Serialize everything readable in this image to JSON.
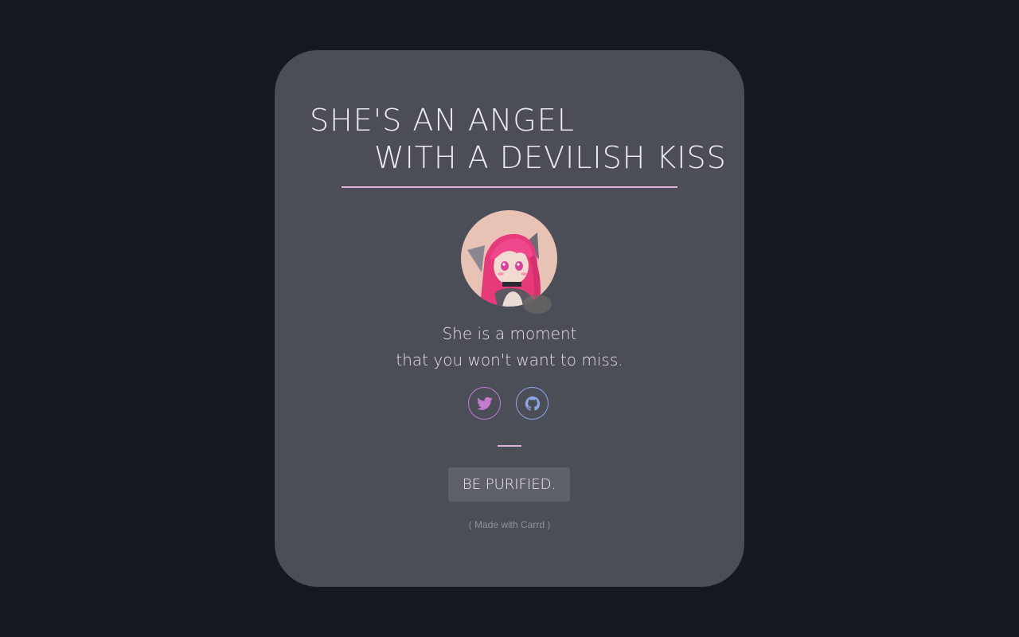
{
  "card": {
    "title_line1": "SHE'S AN ANGEL",
    "title_line2": "WITH A DEVILISH KISS",
    "tagline_line1": "She is a moment",
    "tagline_line2": "that you won't want to miss.",
    "button_label": "BE PURIFIED.",
    "credit": "( Made with Carrd )"
  },
  "social": [
    {
      "icon": "twitter-icon",
      "color": "#c47ad0"
    },
    {
      "icon": "github-icon",
      "color": "#8da6e6"
    }
  ],
  "colors": {
    "background": "#141821",
    "card": "#4b4e57",
    "accent": "#e2b4dc",
    "button": "#5e6169"
  }
}
